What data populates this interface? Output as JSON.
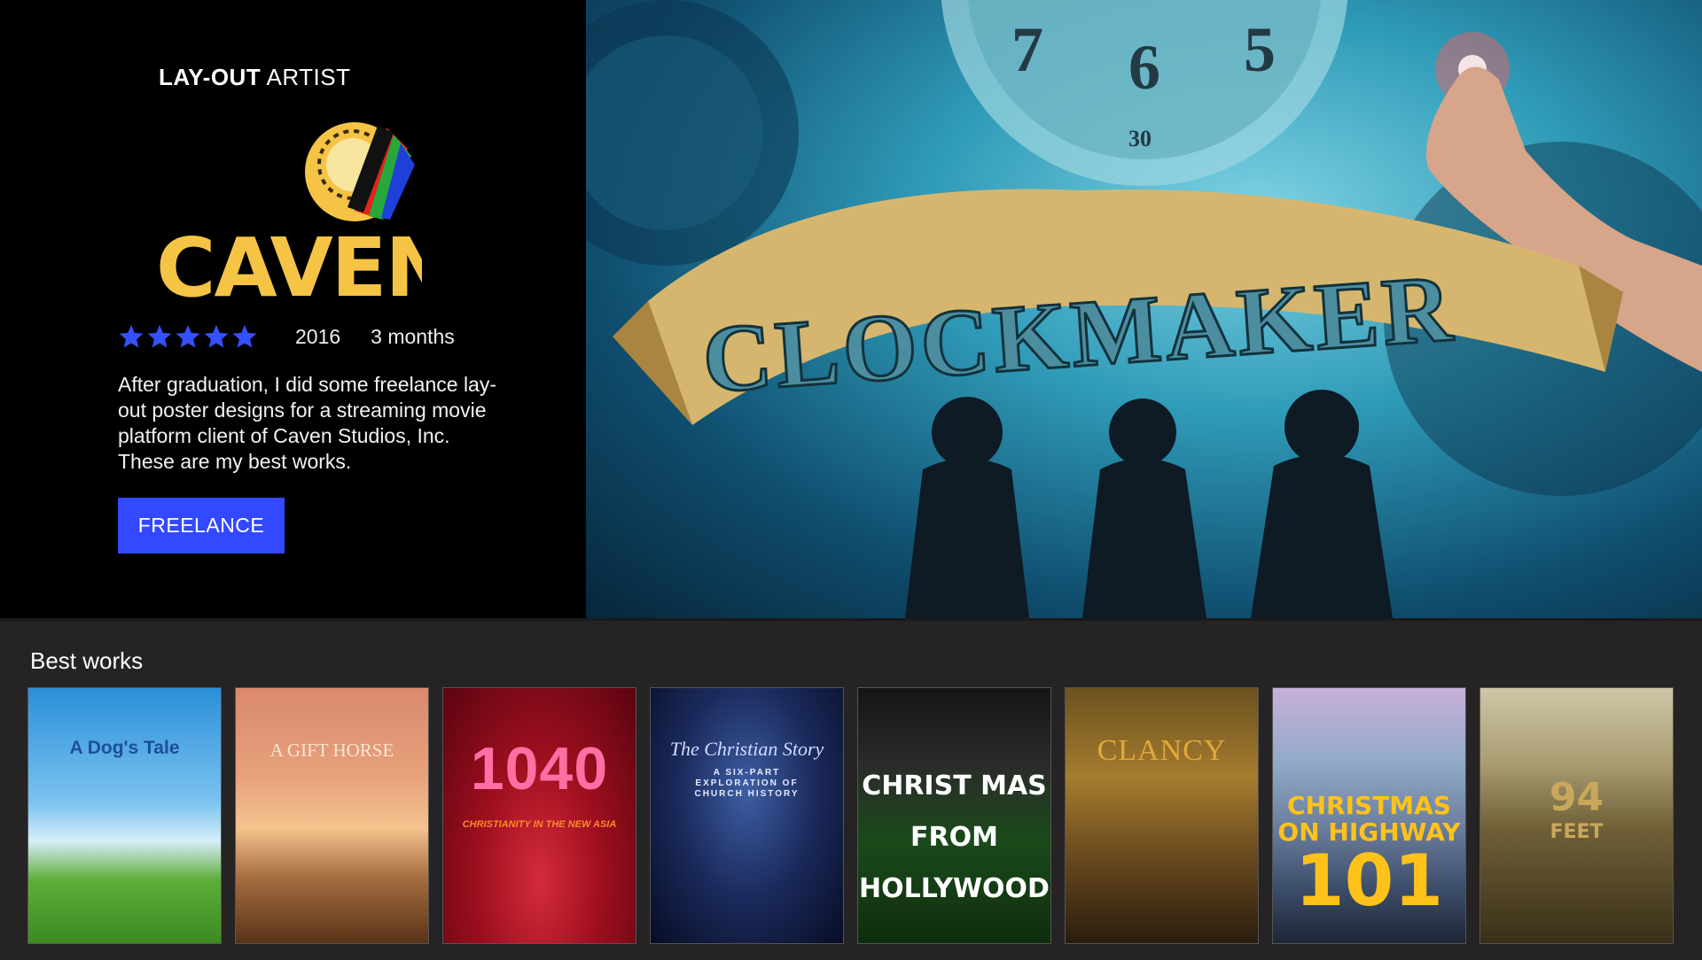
{
  "header": {
    "role_bold": "LAY-OUT",
    "role_rest": " ARTIST"
  },
  "logo": {
    "wordmark": "CAVEN",
    "colors": {
      "yellow": "#f6c445",
      "red": "#e0251b",
      "green": "#27a83a",
      "blue": "#1f3fd9"
    }
  },
  "meta": {
    "rating": 5,
    "year": "2016",
    "duration": "3 months"
  },
  "description": "After graduation, I did some freelance lay-out poster designs for a streaming movie platform client of Caven Studios, Inc. These are my best works.",
  "cta": {
    "label": "FREELANCE"
  },
  "hero_poster": {
    "title": "CLOCKMAKER",
    "clock_numbers": [
      "7",
      "6",
      "5"
    ],
    "clock_minor": "30"
  },
  "best_works": {
    "title": "Best works",
    "posters": [
      {
        "title": "A Dog's Tale",
        "subtitle": ""
      },
      {
        "title": "A GIFT HORSE",
        "subtitle": ""
      },
      {
        "title": "1040",
        "subtitle": "CHRISTIANITY IN THE NEW ASIA"
      },
      {
        "title": "The Christian Story",
        "subtitle": "A SIX-PART EXPLORATION OF CHURCH HISTORY"
      },
      {
        "title": "CHRIST MAS FROM HOLLYWOOD",
        "subtitle": ""
      },
      {
        "title": "CLANCY",
        "subtitle": ""
      },
      {
        "title": "CHRISTMAS ON HIGHWAY",
        "subtitle": "101"
      },
      {
        "title": "94",
        "subtitle": "FEET"
      }
    ]
  },
  "colors": {
    "accent": "#3249ff",
    "star": "#3550ff",
    "works_bg": "#252324"
  }
}
